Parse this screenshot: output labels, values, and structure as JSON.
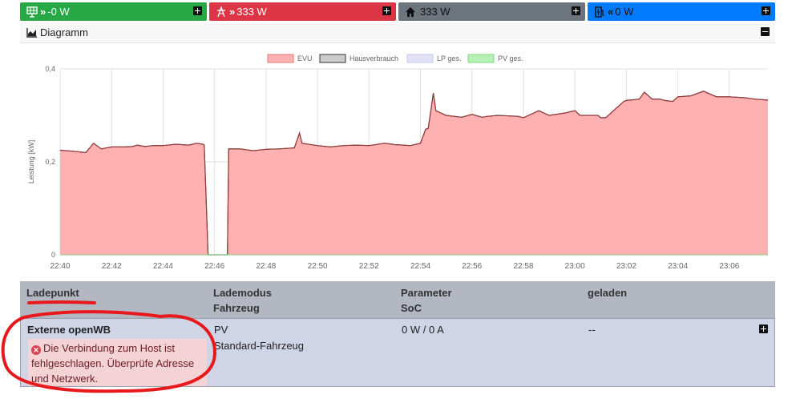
{
  "tiles": [
    {
      "value": "-0 W",
      "color": "#28a745",
      "arrows": "»",
      "icon": "solar-panel-icon"
    },
    {
      "value": "333 W",
      "color": "#dc3545",
      "arrows": "»",
      "icon": "power-tower-icon"
    },
    {
      "value": "333 W",
      "color": "#6c757d",
      "arrows": "",
      "icon": "home-icon"
    },
    {
      "value": "0 W",
      "color": "#007bff",
      "arrows": "«",
      "icon": "charging-station-icon"
    }
  ],
  "diagram": {
    "title": "Diagramm"
  },
  "chart_data": {
    "type": "area",
    "legend": [
      "EVU",
      "Hausverbrauch",
      "LP ges.",
      "PV ges."
    ],
    "legend_position": "top",
    "ylabel": "Leistung [kW]",
    "ylim": [
      0,
      0.4
    ],
    "yticks": [
      "0",
      "0,2",
      "0,4"
    ],
    "xticks": [
      "22:40",
      "22:42",
      "22:44",
      "22:46",
      "22:48",
      "22:50",
      "22:52",
      "22:54",
      "22:56",
      "22:58",
      "23:00",
      "23:02",
      "23:04",
      "23:06"
    ],
    "x_minutes_from_2240": [
      0,
      0.5,
      1,
      1.3,
      1.6,
      2,
      2.5,
      2.8,
      3,
      3.3,
      3.6,
      4,
      4.5,
      5,
      5.3,
      5.55,
      5.6,
      5.75,
      6.35,
      6.5,
      6.55,
      7,
      7.5,
      8,
      8.5,
      9.1,
      9.3,
      9.4,
      10,
      10.5,
      11,
      11.5,
      12,
      12.6,
      12.9,
      13,
      13.6,
      14,
      14.2,
      14.3,
      14.5,
      14.6,
      15,
      15.6,
      16,
      16.4,
      16.6,
      17,
      17.8,
      18,
      18.6,
      19,
      19.6,
      20,
      20.2,
      20.9,
      21,
      21.2,
      21.5,
      21.9,
      22,
      22.5,
      22.7,
      23,
      23.3,
      23.5,
      23.8,
      24,
      24.5,
      25,
      25.5,
      26,
      26.6,
      27,
      27.5
    ],
    "evu_kw": [
      0.225,
      0.223,
      0.22,
      0.24,
      0.228,
      0.232,
      0.232,
      0.233,
      0.236,
      0.233,
      0.235,
      0.235,
      0.238,
      0.236,
      0.24,
      0.238,
      0.236,
      0.0,
      0.0,
      0.0,
      0.228,
      0.228,
      0.224,
      0.227,
      0.228,
      0.23,
      0.262,
      0.24,
      0.235,
      0.232,
      0.235,
      0.236,
      0.235,
      0.24,
      0.238,
      0.237,
      0.235,
      0.24,
      0.27,
      0.272,
      0.348,
      0.31,
      0.3,
      0.296,
      0.302,
      0.296,
      0.298,
      0.3,
      0.298,
      0.295,
      0.31,
      0.3,
      0.305,
      0.31,
      0.3,
      0.3,
      0.295,
      0.295,
      0.31,
      0.33,
      0.332,
      0.335,
      0.35,
      0.335,
      0.335,
      0.332,
      0.33,
      0.34,
      0.342,
      0.352,
      0.34,
      0.34,
      0.338,
      0.335,
      0.333
    ],
    "evu_kw_note": "",
    "grid": true
  },
  "table": {
    "headers": [
      {
        "line1": "Ladepunkt",
        "line2": ""
      },
      {
        "line1": "Lademodus",
        "line2": "Fahrzeug"
      },
      {
        "line1": "Parameter",
        "line2": "SoC"
      },
      {
        "line1": "geladen",
        "line2": ""
      }
    ],
    "row": {
      "name": "Externe openWB",
      "error": "Die Verbindung zum Host ist fehlgeschlagen. Überprüfe Adresse und Netzwerk.",
      "mode": "PV",
      "vehicle": "Standard-Fahrzeug",
      "params": "0 W / 0 A",
      "charged": "--"
    }
  },
  "annotation_color": "#e8191c"
}
